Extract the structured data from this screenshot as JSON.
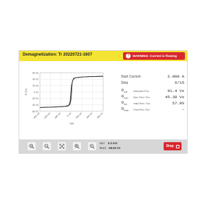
{
  "header": {
    "title": "Demagnetization: Tr 20220721-1607",
    "warning": "WARNING: Current is flowing",
    "warning_icon": "exclamation-icon"
  },
  "chart_data": {
    "type": "line",
    "title": "",
    "ylabel": "Ф (Vs)",
    "xlabel": "I (A)",
    "yticks": [
      "60 Vs",
      "40 Vs",
      "20 Vs",
      "0 Vs",
      "-20 Vs",
      "-40 Vs",
      "-60 Vs"
    ],
    "xticks": [
      "-900 mA",
      "-600 mA",
      "-300 mA",
      "0 mA",
      "300 mA",
      "600 mA",
      "900 mA"
    ],
    "ylim": [
      -60,
      60
    ],
    "xlim": [
      -900,
      900
    ],
    "series": [
      {
        "x": [
          -900,
          -500,
          -200,
          -80,
          -40,
          0,
          40,
          100,
          300,
          600,
          900
        ],
        "y": [
          -48,
          -47,
          -45,
          -42,
          -30,
          20,
          38,
          44,
          47,
          48,
          49
        ]
      },
      {
        "x": [
          900,
          500,
          200,
          60,
          20,
          -10,
          -40,
          -100,
          -300,
          -600,
          -900
        ],
        "y": [
          49,
          48,
          46,
          43,
          30,
          -20,
          -38,
          -44,
          -46,
          -47,
          -48
        ]
      }
    ],
    "grid": true
  },
  "panel": {
    "start_current_label": "Start Current",
    "start_current_value": "2.000 A",
    "step_label": "Step",
    "step_value": "6/15",
    "rows": [
      {
        "symbol": "Φ",
        "sub": "sat",
        "desc": "Saturation Flux",
        "value": "91.4 Vs"
      },
      {
        "symbol": "Φ",
        "sub": "rem",
        "desc": "Max. Rem. Flux",
        "value": "45.38 Vs"
      },
      {
        "symbol": "Φ",
        "sub": "init",
        "desc": "Initial Rem. Flux",
        "value": "57.9%"
      },
      {
        "symbol": "Φ",
        "sub": "final",
        "desc": "Final Rem. Flux",
        "value": "–"
      }
    ]
  },
  "toolbar": {
    "icons": [
      "zoom-in-icon",
      "zoom-out-icon",
      "fit-screen-icon",
      "zoom-reset-icon",
      "pan-icon"
    ],
    "iact_label": "Iact",
    "iact_value": "0.3 mA",
    "phi_label": "Φact",
    "phi_value": "-36.04 Vs",
    "stop_label": "Stop"
  },
  "colors": {
    "header": "#f4e332",
    "warning": "#d8272d",
    "toolbar": "#d7d7d7",
    "curve": "#333333"
  }
}
